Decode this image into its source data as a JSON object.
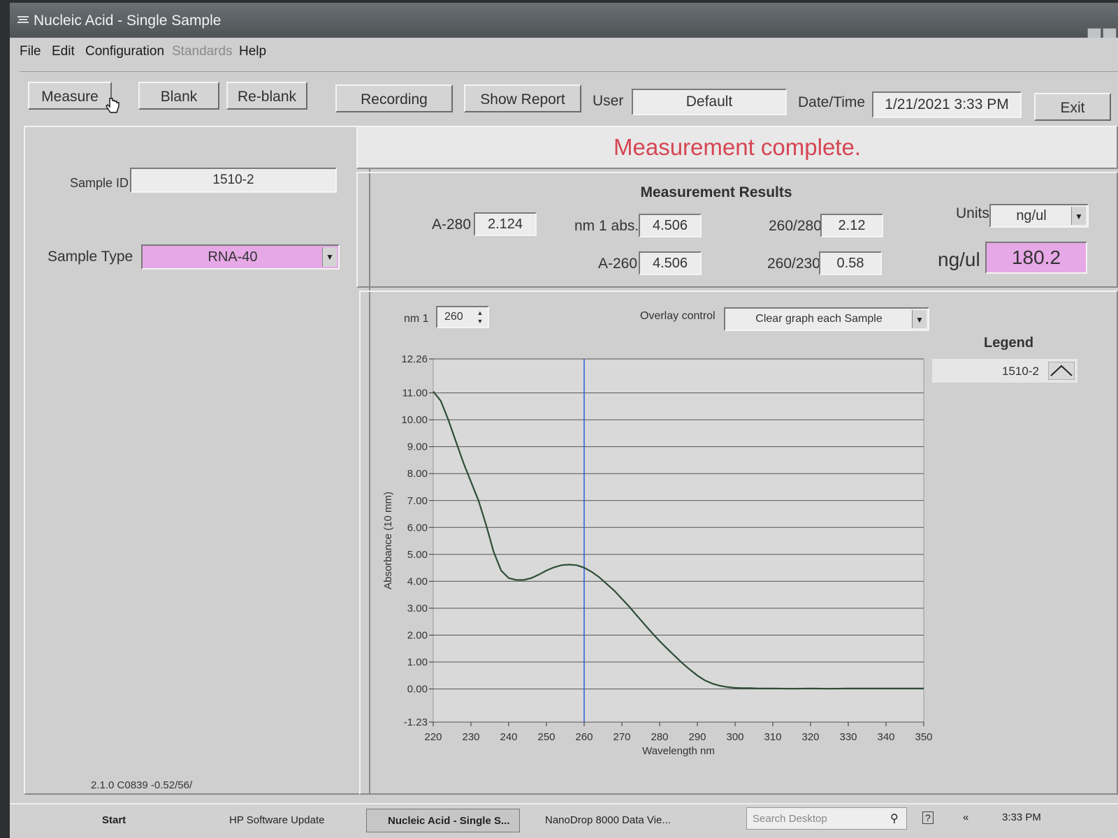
{
  "window": {
    "title": "Nucleic Acid - Single Sample"
  },
  "menu": {
    "file": "File",
    "edit": "Edit",
    "configuration": "Configuration",
    "standards": "Standards",
    "help": "Help"
  },
  "toolbar": {
    "measure": "Measure",
    "blank": "Blank",
    "reblank": "Re-blank",
    "recording": "Recording",
    "show_report": "Show Report",
    "user_label": "User",
    "user_value": "Default",
    "datetime_label": "Date/Time",
    "datetime_value": "1/21/2021  3:33 PM",
    "exit": "Exit"
  },
  "sample": {
    "id_label": "Sample ID",
    "id_value": "1510-2",
    "type_label": "Sample Type",
    "type_value": "RNA-40",
    "type_color": "#e6a8e6"
  },
  "status": {
    "message": "Measurement complete.",
    "color": "#d64553"
  },
  "results": {
    "title": "Measurement Results",
    "a280_label": "A-280",
    "a280_value": "2.124",
    "nm1abs_label": "nm 1 abs.",
    "nm1abs_value": "4.506",
    "a260_label": "A-260",
    "a260_value": "4.506",
    "r260_280_label": "260/280",
    "r260_280_value": "2.12",
    "r260_230_label": "260/230",
    "r260_230_value": "0.58",
    "units_label": "Units",
    "units_value": "ng/ul",
    "conc_label": "ng/ul",
    "conc_value": "180.2",
    "conc_color": "#e6a8e6"
  },
  "graph_controls": {
    "nm1_label": "nm 1",
    "nm1_value": "260",
    "overlay_label": "Overlay control",
    "overlay_value": "Clear graph each Sample",
    "legend_title": "Legend",
    "legend_item": "1510-2"
  },
  "chart_data": {
    "type": "line",
    "xlabel": "Wavelength nm",
    "ylabel": "Absorbance (10 mm)",
    "xlim": [
      220,
      350
    ],
    "ylim": [
      -1.23,
      12.26
    ],
    "x_ticks": [
      "220",
      "230",
      "240",
      "250",
      "260",
      "270",
      "280",
      "290",
      "300",
      "310",
      "320",
      "330",
      "340",
      "350"
    ],
    "y_ticks": [
      "12.26",
      "11.00",
      "10.00",
      "9.00",
      "8.00",
      "7.00",
      "6.00",
      "5.00",
      "4.00",
      "3.00",
      "2.00",
      "1.00",
      "0.00",
      "-1.23"
    ],
    "grid": true,
    "cursor_x": 260,
    "series": [
      {
        "name": "1510-2",
        "color": "#2e4d36",
        "x": [
          220,
          222,
          224,
          226,
          228,
          230,
          232,
          234,
          236,
          238,
          240,
          242,
          244,
          246,
          248,
          250,
          252,
          254,
          256,
          258,
          260,
          262,
          264,
          266,
          268,
          270,
          272,
          274,
          276,
          278,
          280,
          282,
          284,
          286,
          288,
          290,
          292,
          294,
          296,
          298,
          300,
          302,
          304,
          306,
          310,
          315,
          320,
          325,
          330,
          335,
          340,
          345,
          350
        ],
        "y": [
          11.05,
          10.7,
          10.0,
          9.2,
          8.4,
          7.7,
          7.0,
          6.1,
          5.1,
          4.4,
          4.12,
          4.05,
          4.05,
          4.12,
          4.25,
          4.4,
          4.52,
          4.6,
          4.62,
          4.6,
          4.506,
          4.35,
          4.15,
          3.9,
          3.65,
          3.35,
          3.05,
          2.72,
          2.4,
          2.08,
          1.78,
          1.5,
          1.23,
          0.96,
          0.72,
          0.5,
          0.32,
          0.2,
          0.12,
          0.07,
          0.04,
          0.03,
          0.03,
          0.02,
          0.02,
          0.01,
          0.02,
          0.01,
          0.02,
          0.02,
          0.02,
          0.02,
          0.02
        ]
      }
    ]
  },
  "version": "2.1.0 C0839 -0.52/56/",
  "taskbar": {
    "start": "Start",
    "hp_update": "HP Software Update",
    "task1": "Nucleic Acid - Single S...",
    "task2": "NanoDrop 8000 Data Vie...",
    "search": "Search Desktop",
    "clock": "3:33 PM"
  }
}
